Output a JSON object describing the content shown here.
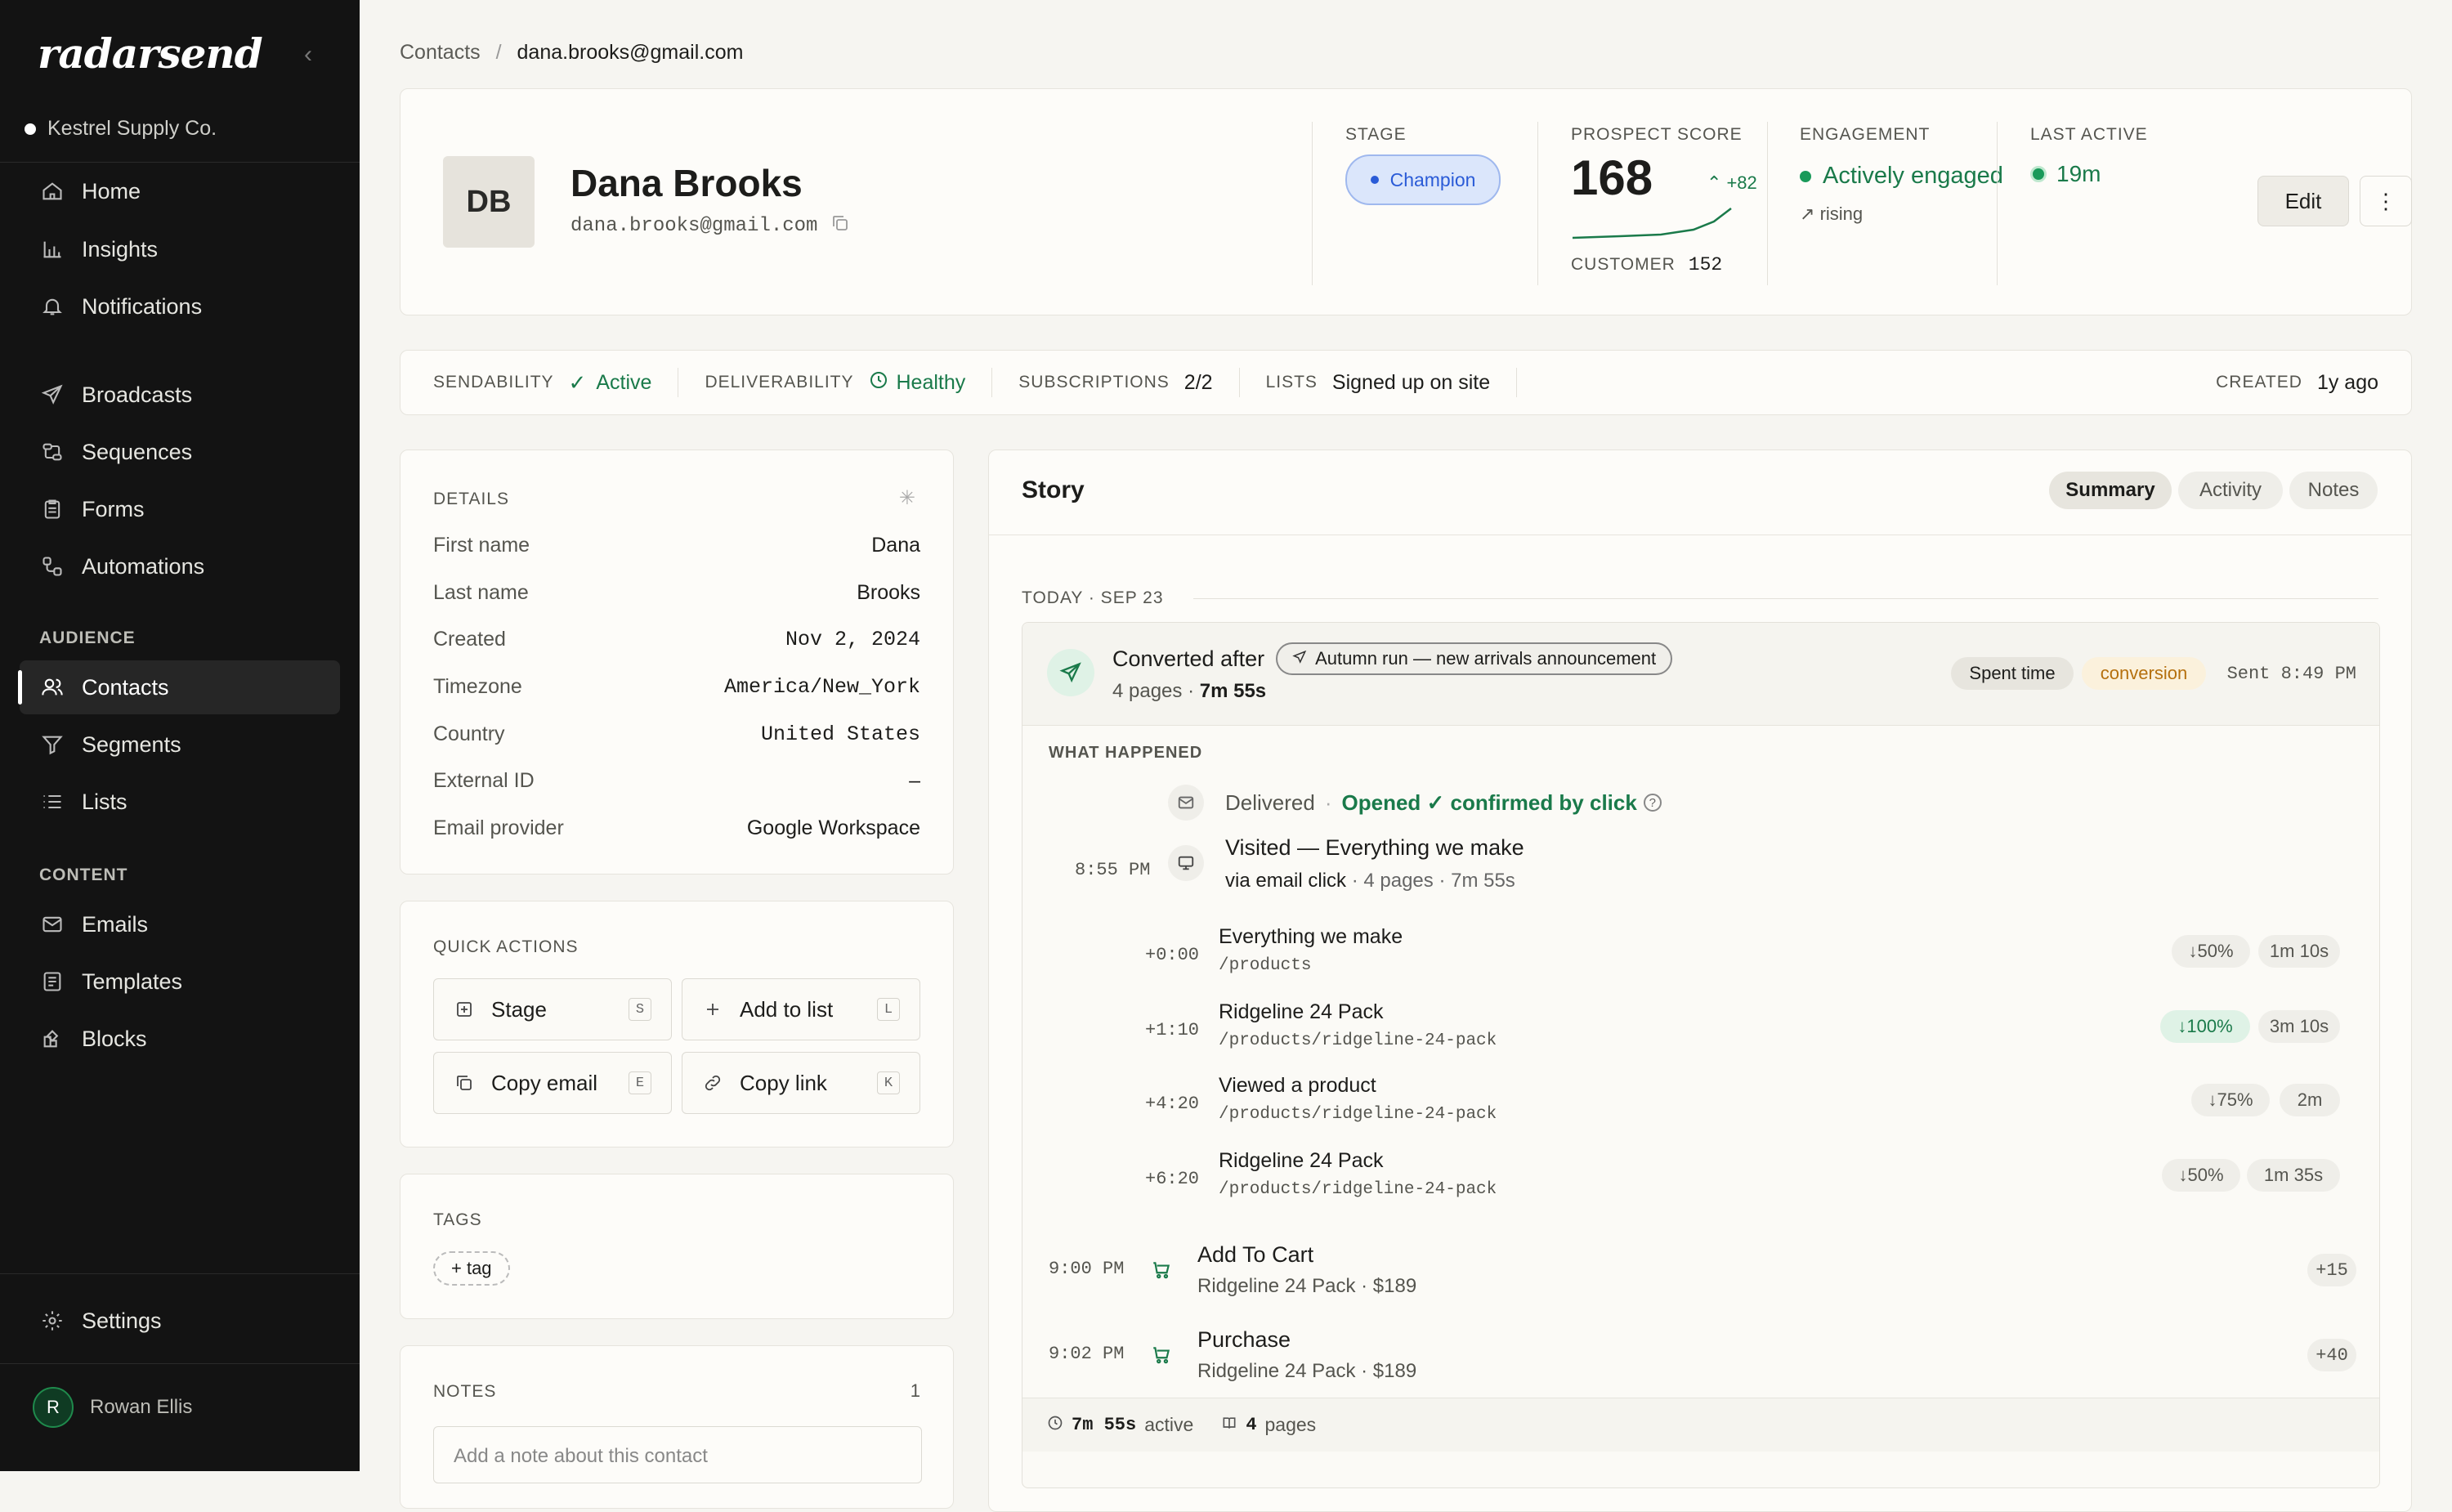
{
  "app": {
    "logo": "radarsend",
    "workspace": "Kestrel Supply Co."
  },
  "sidebar": {
    "nav": [
      {
        "label": "Home",
        "icon": "home-icon"
      },
      {
        "label": "Insights",
        "icon": "bar-chart-icon"
      },
      {
        "label": "Notifications",
        "icon": "bell-icon"
      }
    ],
    "messaging": [
      {
        "label": "Broadcasts",
        "icon": "send-icon"
      },
      {
        "label": "Sequences",
        "icon": "sequence-icon"
      },
      {
        "label": "Forms",
        "icon": "clipboard-icon"
      },
      {
        "label": "Automations",
        "icon": "automation-icon"
      }
    ],
    "audience_label": "AUDIENCE",
    "audience": [
      {
        "label": "Contacts",
        "icon": "users-icon",
        "active": true
      },
      {
        "label": "Segments",
        "icon": "filter-icon"
      },
      {
        "label": "Lists",
        "icon": "list-icon"
      }
    ],
    "content_label": "CONTENT",
    "content": [
      {
        "label": "Emails",
        "icon": "mail-icon"
      },
      {
        "label": "Templates",
        "icon": "template-icon"
      },
      {
        "label": "Blocks",
        "icon": "blocks-icon"
      }
    ],
    "settings": "Settings",
    "user": {
      "initial": "R",
      "name": "Rowan Ellis"
    }
  },
  "breadcrumb": {
    "root": "Contacts",
    "separator": "/",
    "current": "dana.brooks@gmail.com"
  },
  "contact": {
    "initials": "DB",
    "name": "Dana Brooks",
    "email": "dana.brooks@gmail.com"
  },
  "header_stats": {
    "stage_label": "STAGE",
    "stage": "Champion",
    "score_label": "PROSPECT SCORE",
    "score": "168",
    "score_delta": "+82",
    "customer_label": "CUSTOMER",
    "customer_score": "152",
    "engagement_label": "ENGAGEMENT",
    "engagement": "Actively engaged",
    "engagement_trend": "rising",
    "last_active_label": "LAST ACTIVE",
    "last_active": "19m",
    "edit": "Edit"
  },
  "status_bar": {
    "sendability_label": "SENDABILITY",
    "sendability": "Active",
    "deliverability_label": "DELIVERABILITY",
    "deliverability": "Healthy",
    "subscriptions_label": "SUBSCRIPTIONS",
    "subscriptions": "2/2",
    "lists_label": "LISTS",
    "lists": "Signed up on site",
    "created_label": "CREATED",
    "created": "1y ago"
  },
  "details": {
    "title": "DETAILS",
    "rows": [
      {
        "k": "First name",
        "v": "Dana"
      },
      {
        "k": "Last name",
        "v": "Brooks"
      },
      {
        "k": "Created",
        "v": "Nov 2, 2024"
      },
      {
        "k": "Timezone",
        "v": "America/New_York"
      },
      {
        "k": "Country",
        "v": "United States"
      },
      {
        "k": "External ID",
        "v": "–"
      },
      {
        "k": "Email provider",
        "v": "Google Workspace"
      }
    ]
  },
  "quick_actions": {
    "title": "QUICK ACTIONS",
    "items": [
      {
        "label": "Stage",
        "key": "S"
      },
      {
        "label": "Add to list",
        "key": "L"
      },
      {
        "label": "Copy email",
        "key": "E"
      },
      {
        "label": "Copy link",
        "key": "K"
      }
    ]
  },
  "tags": {
    "title": "TAGS",
    "add": "+ tag"
  },
  "notes": {
    "title": "NOTES",
    "count": "1",
    "placeholder": "Add a note about this contact"
  },
  "story": {
    "title": "Story",
    "tabs": [
      "Summary",
      "Activity",
      "Notes"
    ],
    "date": "TODAY · SEP 23",
    "event": {
      "title": "Converted after",
      "campaign": "Autumn run — new arrivals announcement",
      "pages": "4 pages",
      "duration": "7m 55s",
      "tag1": "Spent time",
      "tag2": "conversion",
      "sent": "Sent 8:49 PM"
    },
    "what_happened": "WHAT HAPPENED",
    "delivered": "Delivered",
    "opened": "Opened ✓ confirmed by click",
    "visit": {
      "time": "8:55 PM",
      "title": "Visited — Everything we make",
      "via": "via email click",
      "meta": "· 4 pages · 7m 55s"
    },
    "pages": [
      {
        "offset": "+0:00",
        "title": "Everything we make",
        "path": "/products",
        "scroll": "↓50%",
        "time": "1m 10s"
      },
      {
        "offset": "+1:10",
        "title": "Ridgeline 24 Pack",
        "path": "/products/ridgeline-24-pack",
        "scroll": "↓100%",
        "time": "3m 10s"
      },
      {
        "offset": "+4:20",
        "title": "Viewed a product",
        "path": "/products/ridgeline-24-pack",
        "scroll": "↓75%",
        "time": "2m"
      },
      {
        "offset": "+6:20",
        "title": "Ridgeline 24 Pack",
        "path": "/products/ridgeline-24-pack",
        "scroll": "↓50%",
        "time": "1m 35s"
      }
    ],
    "actions": [
      {
        "time": "9:00 PM",
        "title": "Add To Cart",
        "detail": "Ridgeline 24 Pack · $189",
        "points": "+15"
      },
      {
        "time": "9:02 PM",
        "title": "Purchase",
        "detail": "Ridgeline 24 Pack · $189",
        "points": "+40"
      }
    ],
    "footer": {
      "active_time": "7m 55s",
      "active_label": "active",
      "pages": "4",
      "pages_label": "pages"
    }
  },
  "colors": {
    "accent_green": "#1a7a4a",
    "stage_blue": "#2a5bd7",
    "conversion": "#b5700e"
  }
}
